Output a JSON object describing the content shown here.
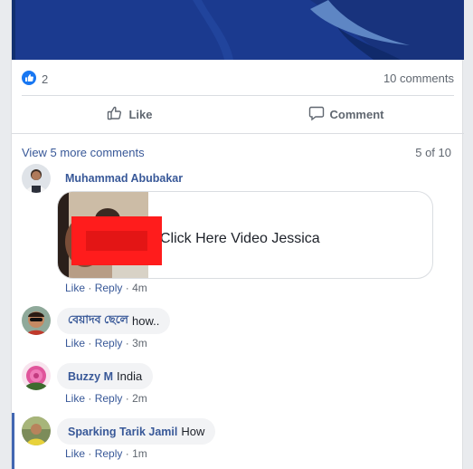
{
  "post": {
    "reactions_count": "2",
    "comments_count": "10 comments",
    "like_label": "Like",
    "comment_label": "Comment"
  },
  "comments_section": {
    "view_more": "View 5 more comments",
    "pager": "5 of 10",
    "action_like": "Like",
    "action_reply": "Reply",
    "separator": "·",
    "items": [
      {
        "author": "Muhammad Abubakar",
        "text": "",
        "time": "4m",
        "preview_title": "Click Here Video Jessica"
      },
      {
        "author": "বেয়াদব ছেলে",
        "text": "how..",
        "time": "3m"
      },
      {
        "author": "Buzzy M",
        "text": "India",
        "time": "2m"
      },
      {
        "author": "Sparking Tarik Jamil",
        "text": "How",
        "time": "1m"
      }
    ]
  },
  "colors": {
    "link": "#385898",
    "like_badge": "#1877f2",
    "banner": "#1b3a8f",
    "redaction": "#ff1c1c"
  }
}
